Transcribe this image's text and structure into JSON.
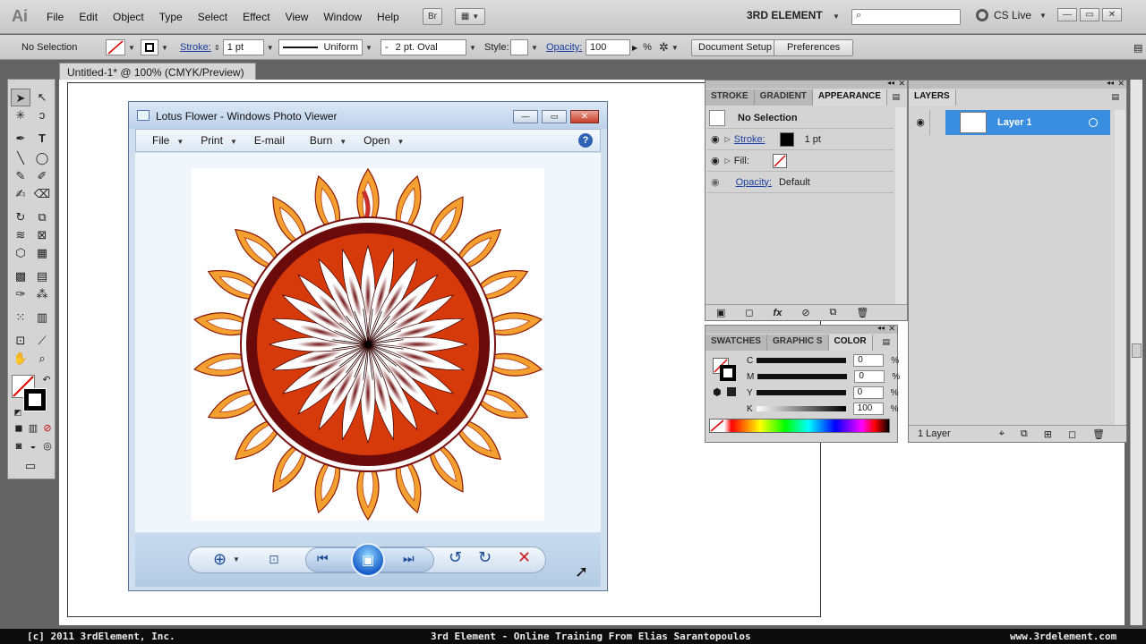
{
  "app": {
    "logo": "Ai",
    "menu": [
      "File",
      "Edit",
      "Object",
      "Type",
      "Select",
      "Effect",
      "View",
      "Window",
      "Help"
    ],
    "bridge_button": "Br",
    "workspace": "3RD ELEMENT",
    "cs_live": "CS Live"
  },
  "control_bar": {
    "selection": "No Selection",
    "stroke_label": "Stroke:",
    "stroke_weight": "1 pt",
    "stroke_profile": "Uniform",
    "brush": "2 pt. Oval",
    "style_label": "Style:",
    "opacity_label": "Opacity:",
    "opacity_value": "100",
    "opacity_unit": "%",
    "document_setup": "Document Setup",
    "preferences": "Preferences"
  },
  "document": {
    "tab_title": "Untitled-1* @ 100% (CMYK/Preview)"
  },
  "photo_viewer": {
    "title": "Lotus Flower - Windows Photo Viewer",
    "menu": [
      "File",
      "Print",
      "E-mail",
      "Burn",
      "Open"
    ],
    "menu_has_dropdown": [
      true,
      true,
      false,
      true,
      true
    ]
  },
  "appearance_panel": {
    "tabs": [
      "STROKE",
      "GRADIENT",
      "APPEARANCE"
    ],
    "active_tab": "APPEARANCE",
    "header": "No Selection",
    "stroke_label": "Stroke:",
    "stroke_value": "1 pt",
    "fill_label": "Fill:",
    "opacity_label": "Opacity:",
    "opacity_value": "Default"
  },
  "color_panel": {
    "tabs": [
      "SWATCHES",
      "GRAPHIC S",
      "COLOR"
    ],
    "active_tab": "COLOR",
    "channels": [
      {
        "label": "C",
        "value": "0",
        "unit": "%"
      },
      {
        "label": "M",
        "value": "0",
        "unit": "%"
      },
      {
        "label": "Y",
        "value": "0",
        "unit": "%"
      },
      {
        "label": "K",
        "value": "100",
        "unit": "%"
      }
    ]
  },
  "layers_panel": {
    "tab": "LAYERS",
    "layer_name": "Layer 1",
    "footer": "1 Layer"
  },
  "footer": {
    "left": "[c] 2011 3rdElement, Inc.",
    "center": "3rd Element - Online Training From Elias Sarantopoulos",
    "right": "www.3rdelement.com"
  },
  "colors": {
    "accent": "#3a8ee0",
    "lotus_dark": "#6b0a0a",
    "lotus_orange": "#d63a0a",
    "lotus_petal": "#f4a030"
  }
}
